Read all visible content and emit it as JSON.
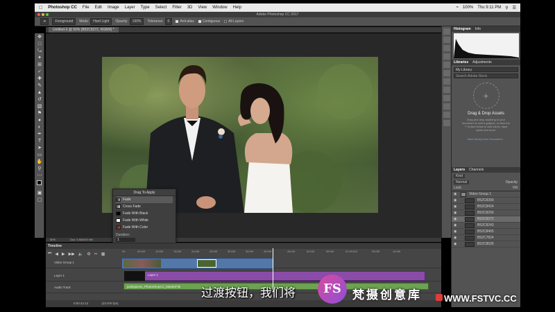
{
  "menubar": {
    "app": "Photoshop CC",
    "items": [
      "File",
      "Edit",
      "Image",
      "Layer",
      "Type",
      "Select",
      "Filter",
      "3D",
      "View",
      "Window",
      "Help"
    ],
    "battery": "100%",
    "clock": "Thu 9:11 PM"
  },
  "window_title": "Adobe Photoshop CC 2017",
  "options": {
    "preset": "Foreground",
    "mode_label": "Mode:",
    "mode_value": "Hard Light",
    "opacity_label": "Opacity:",
    "opacity_value": "100%",
    "tolerance_label": "Tolerance:",
    "tolerance_value": "0",
    "antialias": "Anti-alias",
    "contiguous": "Contiguous",
    "all_layers": "All Layers"
  },
  "document_tab": "Untitled-3 @ 50% (B52C8372, RGB/8) *",
  "status": {
    "zoom": "50%",
    "doc": "Doc: 5.93M/47.9M"
  },
  "transition_popup": {
    "title": "Drag To Apply",
    "options": [
      "Fade",
      "Cross Fade",
      "Fade With Black",
      "Fade With White",
      "Fade With Color"
    ],
    "selected": "Fade",
    "duration_label": "Duration:",
    "duration_value": "1"
  },
  "panels": {
    "histogram_tabs": [
      "Histogram",
      "Info"
    ],
    "library_tabs": [
      "Libraries",
      "Adjustments"
    ],
    "library_select": "My Library",
    "library_search": "Search Adobe Stock",
    "library_title": "Drag & Drop Assets",
    "library_text": "Drag and drop anything in your document to add a graphic, or click the '+' button below to add colors, layer styles and more.",
    "library_link": "New Library from Document...",
    "layers_tabs": [
      "Layers",
      "Channels"
    ],
    "layers_kind": "Kind",
    "layers_mode": "Normal",
    "layers_opacity": "Opacity:",
    "layers_lock": "Lock:",
    "layers_fill": "Fill:",
    "layers": [
      {
        "name": "Video Group 1",
        "group": true
      },
      {
        "name": "B52C8390",
        "group": false
      },
      {
        "name": "B52C8424",
        "group": false
      },
      {
        "name": "B52C8256",
        "group": false
      },
      {
        "name": "B52C8372",
        "group": false,
        "selected": true
      },
      {
        "name": "B52C8243",
        "group": false
      },
      {
        "name": "B52C8465",
        "group": false
      },
      {
        "name": "B52C7824",
        "group": false
      },
      {
        "name": "B52C8505",
        "group": false
      }
    ]
  },
  "timeline": {
    "title": "Timeline",
    "ruler": [
      "00",
      "00:00f",
      "10:00f",
      "15:00f",
      "20:00f",
      "25:00f",
      "30:00f",
      "35:00f",
      "40:00f",
      "45:00f",
      "50:00f",
      "55:00f",
      "01:00:00f",
      "05:00f",
      "10:00f"
    ],
    "tracks": [
      "Video Group 1",
      "Layer 1",
      "Audio Track"
    ],
    "clip_layer": "Layer 1",
    "clip_audio": "justinjames_PhotoShopCC_MasterFile",
    "timecode": "0:00:42:12",
    "fps": "(23.976 fps)"
  },
  "overlay": {
    "subtitle": "过渡按钮，我们将",
    "logo": "FS",
    "brand": "梵摄创意库",
    "url": "WWW.FSTVC.CC"
  }
}
